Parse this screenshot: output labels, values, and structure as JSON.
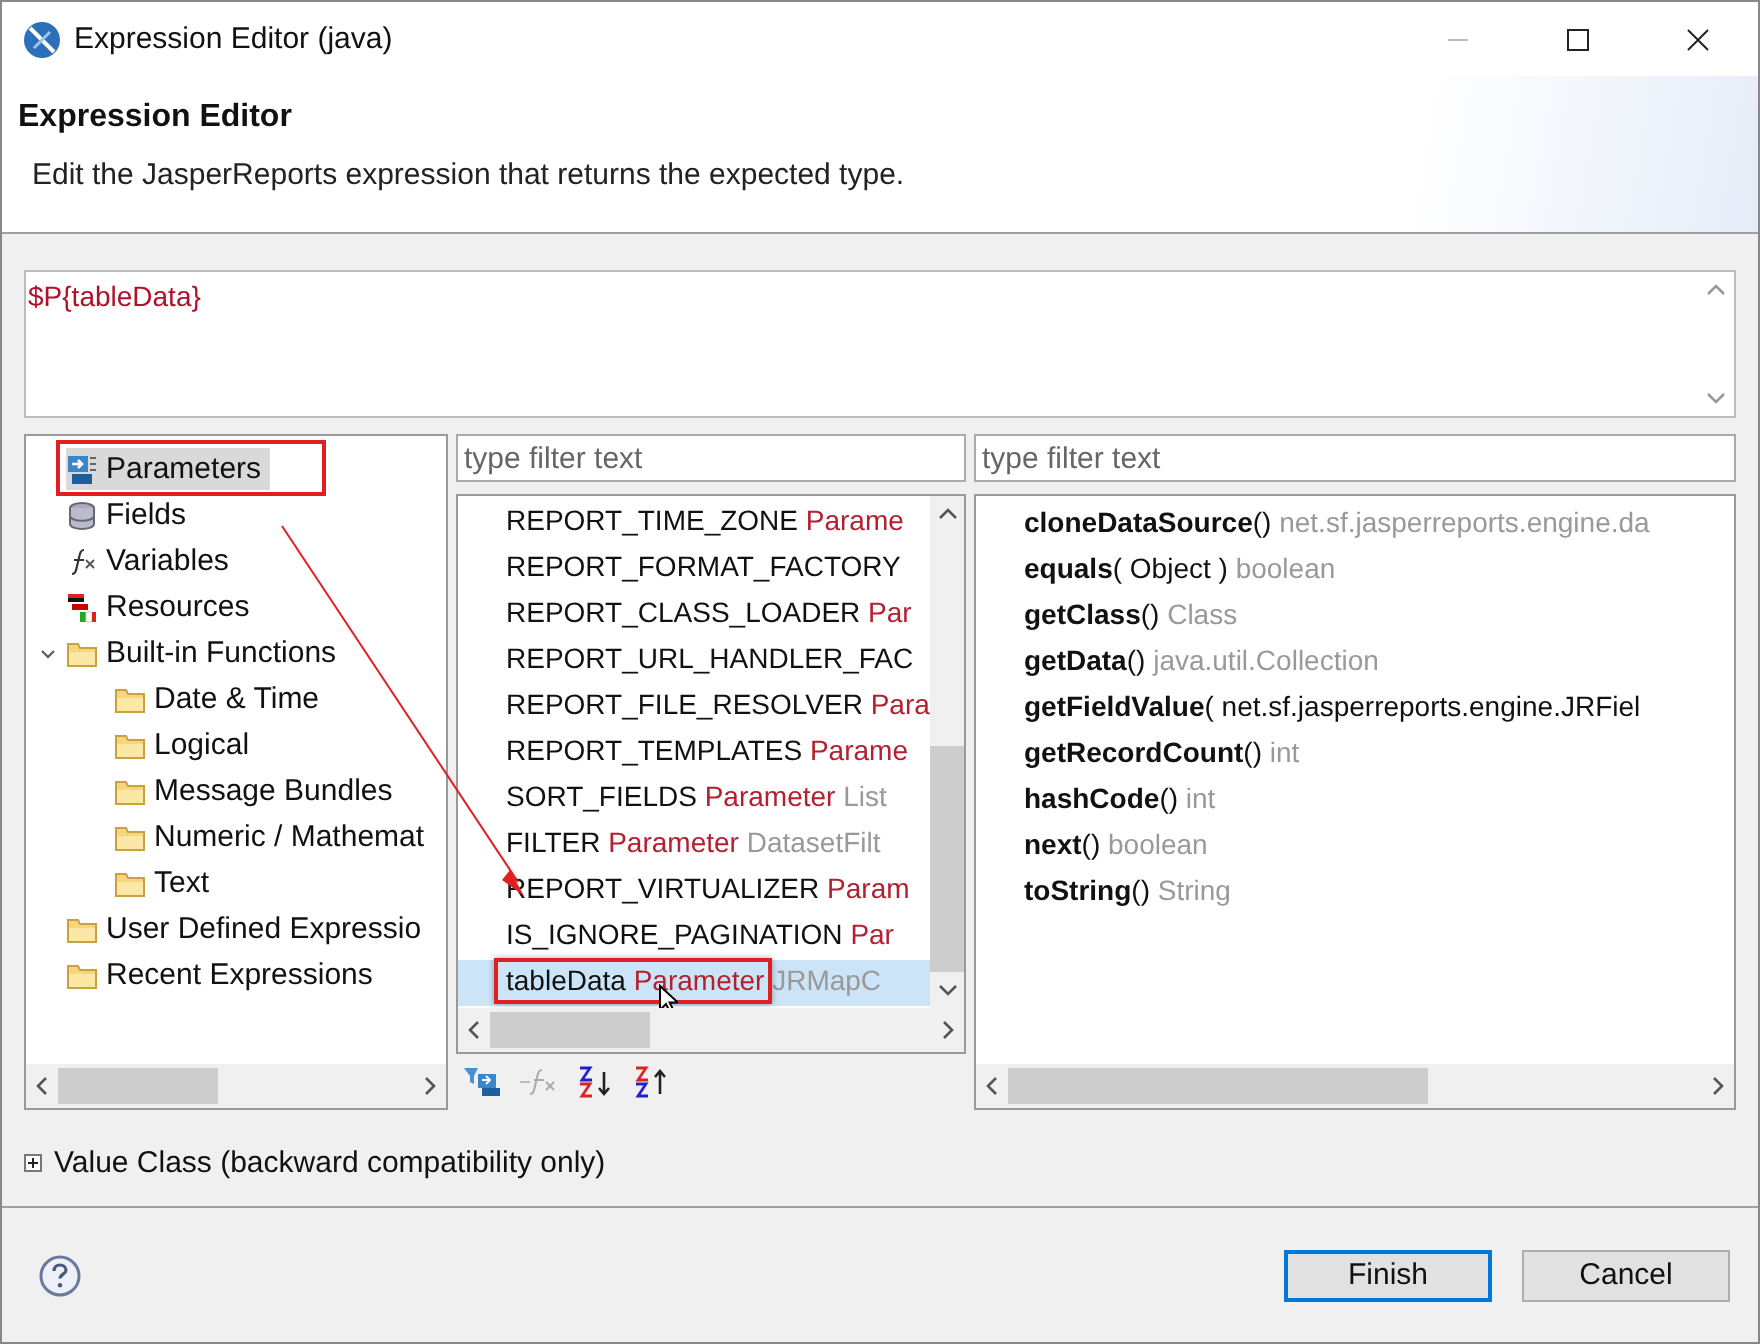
{
  "window": {
    "title": "Expression Editor (java)"
  },
  "header": {
    "title": "Expression Editor",
    "description": "Edit the JasperReports expression that returns the expected type."
  },
  "expression": {
    "value": "$P{tableData}"
  },
  "categories": [
    {
      "label": "Parameters",
      "kind": "parameters",
      "selected": true
    },
    {
      "label": "Fields",
      "kind": "fields",
      "selected": false
    },
    {
      "label": "Variables",
      "kind": "variables",
      "selected": false
    },
    {
      "label": "Resources",
      "kind": "resources",
      "selected": false
    },
    {
      "label": "Built-in Functions",
      "kind": "folder",
      "selected": false,
      "expanded": true,
      "children": [
        {
          "label": "Date & Time",
          "kind": "folder",
          "selected": false
        },
        {
          "label": "Logical",
          "kind": "folder",
          "selected": false
        },
        {
          "label": "Message Bundles",
          "kind": "folder",
          "selected": false
        },
        {
          "label": "Numeric / Mathemat",
          "kind": "folder",
          "selected": false
        },
        {
          "label": "Text",
          "kind": "folder",
          "selected": false
        }
      ]
    },
    {
      "label": "User Defined Expressio",
      "kind": "folder",
      "selected": false
    },
    {
      "label": "Recent Expressions",
      "kind": "folder",
      "selected": false
    }
  ],
  "objects_filter": {
    "placeholder": "type filter text"
  },
  "objects": [
    {
      "name": "REPORT_TIME_ZONE",
      "category": "Parame",
      "selected": false
    },
    {
      "name": "REPORT_FORMAT_FACTORY",
      "selected": false
    },
    {
      "name": "REPORT_CLASS_LOADER",
      "category": "Par",
      "selected": false
    },
    {
      "name": "REPORT_URL_HANDLER_FAC",
      "selected": false
    },
    {
      "name": "REPORT_FILE_RESOLVER",
      "category": "Para",
      "selected": false
    },
    {
      "name": "REPORT_TEMPLATES",
      "category": "Parame",
      "selected": false
    },
    {
      "name": "SORT_FIELDS",
      "category": "Parameter",
      "type": "List",
      "selected": false
    },
    {
      "name": "FILTER",
      "category": "Parameter",
      "type": "DatasetFilt",
      "selected": false
    },
    {
      "name": "REPORT_VIRTUALIZER",
      "category": "Param",
      "selected": false
    },
    {
      "name": "IS_IGNORE_PAGINATION",
      "category": "Par",
      "selected": false
    },
    {
      "name": "tableData",
      "category": "Parameter",
      "type": "JRMapC",
      "selected": true
    }
  ],
  "methods_filter": {
    "placeholder": "type filter text"
  },
  "methods": [
    {
      "name": "cloneDataSource",
      "args": "()",
      "returns": "net.sf.jasperreports.engine.da"
    },
    {
      "name": "equals",
      "args": "( Object )",
      "returns": "boolean"
    },
    {
      "name": "getClass",
      "args": "()",
      "returns": "Class"
    },
    {
      "name": "getData",
      "args": "()",
      "returns": "java.util.Collection"
    },
    {
      "name": "getFieldValue",
      "args": "( net.sf.jasperreports.engine.JRFiel"
    },
    {
      "name": "getRecordCount",
      "args": "()",
      "returns": "int"
    },
    {
      "name": "hashCode",
      "args": "()",
      "returns": "int"
    },
    {
      "name": "next",
      "args": "()",
      "returns": "boolean"
    },
    {
      "name": "toString",
      "args": "()",
      "returns": "String"
    }
  ],
  "value_class": {
    "label": "Value Class (backward compatibility only)",
    "expanded": false
  },
  "buttons": [
    {
      "label": "Finish",
      "default": true
    },
    {
      "label": "Cancel",
      "default": false
    }
  ]
}
